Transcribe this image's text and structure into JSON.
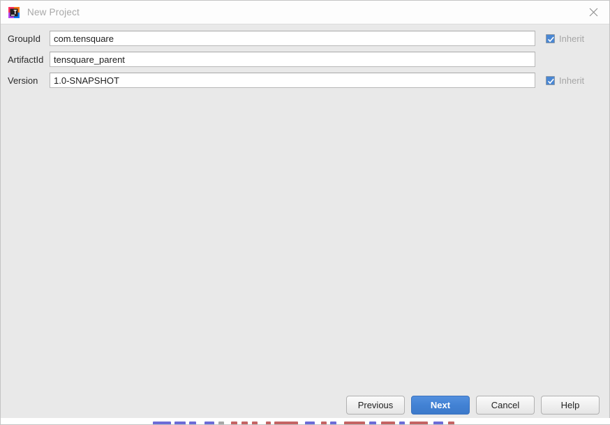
{
  "window": {
    "title": "New Project",
    "app_icon": "intellij-idea-icon",
    "close_icon": "close-icon"
  },
  "form": {
    "rows": [
      {
        "label": "GroupId",
        "value": "com.tensquare",
        "placeholder": "",
        "inherit_label": "Inherit",
        "inherit_checked": true,
        "has_inherit": true,
        "name": "groupid"
      },
      {
        "label": "ArtifactId",
        "value": "tensquare_parent",
        "placeholder": "",
        "inherit_label": "",
        "inherit_checked": false,
        "has_inherit": false,
        "name": "artifactid"
      },
      {
        "label": "Version",
        "value": "1.0-SNAPSHOT",
        "placeholder": "",
        "inherit_label": "Inherit",
        "inherit_checked": true,
        "has_inherit": true,
        "name": "version"
      }
    ]
  },
  "buttons": {
    "previous": "Previous",
    "next": "Next",
    "cancel": "Cancel",
    "help": "Help"
  },
  "colors": {
    "accent": "#4282d4",
    "checkbox": "#4a87d3",
    "dialog_bg": "#e9e9e9",
    "titlebar_bg": "#fdfdfd",
    "field_bg": "#ffffff",
    "disabled_text": "#a6a6a6"
  }
}
